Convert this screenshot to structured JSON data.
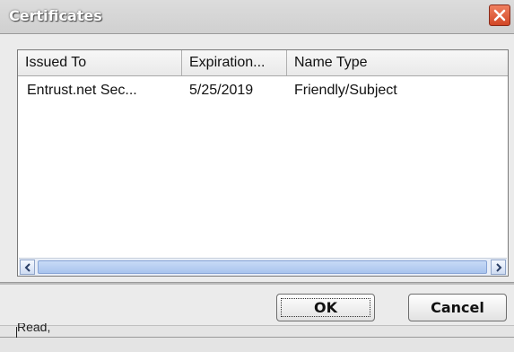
{
  "window": {
    "title": "Certificates",
    "close_icon": "close-icon",
    "accent_close": "#d24726"
  },
  "listview": {
    "columns": [
      {
        "label": "Issued To"
      },
      {
        "label": "Expiration..."
      },
      {
        "label": "Name Type"
      }
    ],
    "rows": [
      {
        "issued_to": "Entrust.net Sec...",
        "expiration": "5/25/2019",
        "name_type": "Friendly/Subject"
      }
    ]
  },
  "scrollbar": {
    "left_icon": "chevron-left-icon",
    "right_icon": "chevron-right-icon"
  },
  "buttons": {
    "ok_label": "OK",
    "cancel_label": "Cancel"
  },
  "background": {
    "partial_label": "Read,"
  }
}
